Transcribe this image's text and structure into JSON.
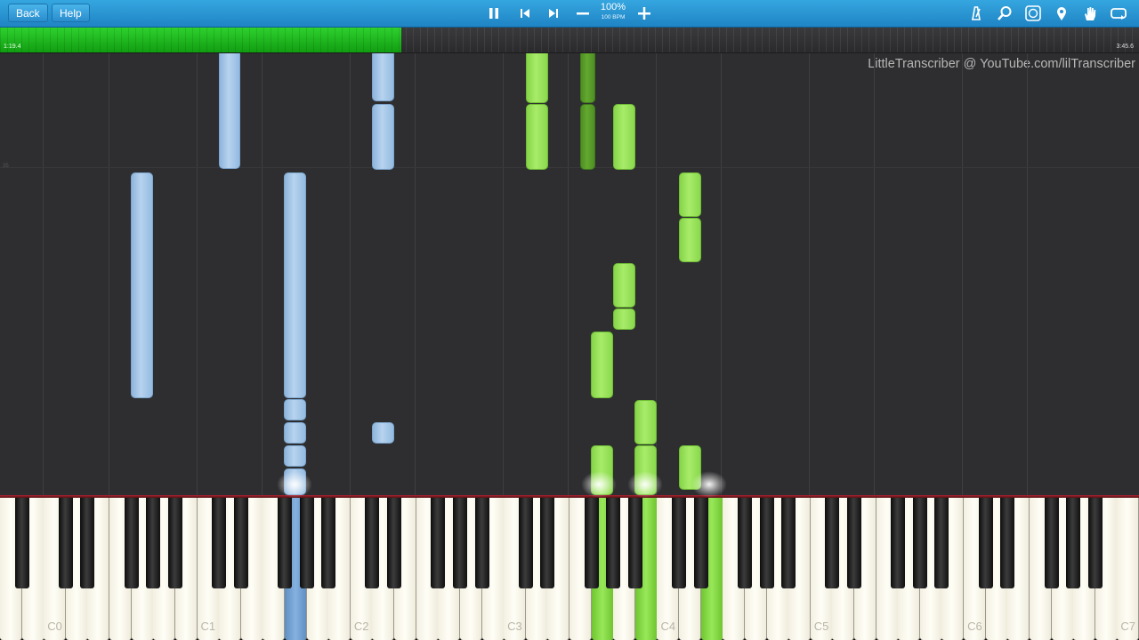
{
  "toolbar": {
    "back_label": "Back",
    "help_label": "Help",
    "speed_percent": "100%",
    "speed_bpm": "100 BPM",
    "icons": [
      "pause-icon",
      "skip-back-icon",
      "skip-forward-icon",
      "minus-icon",
      "plus-icon",
      "metronome-icon",
      "magnifier-icon",
      "key-label-icon",
      "location-pin-icon",
      "hand-icon",
      "loop-icon"
    ]
  },
  "progress": {
    "elapsed": "1:19.4",
    "total": "3:45.6",
    "fraction": 0.352
  },
  "credit": "LittleTranscriber @ YouTube.com/lilTranscriber",
  "measure_number": "35",
  "keyboard": {
    "octave_labels": [
      "C0",
      "C1",
      "C2",
      "C3",
      "C4",
      "C5",
      "C6",
      "C7"
    ],
    "pressed_keys": [
      {
        "key": "C2 region",
        "hand": "left"
      },
      {
        "key": "C3/C4 region",
        "hand": "right"
      }
    ]
  },
  "colors": {
    "left_hand": "#a9c9ea",
    "right_hand": "#96e05a",
    "right_hand_dark": "#5a9c2a",
    "toolbar": "#2591d1",
    "progress": "#1fb81f"
  }
}
